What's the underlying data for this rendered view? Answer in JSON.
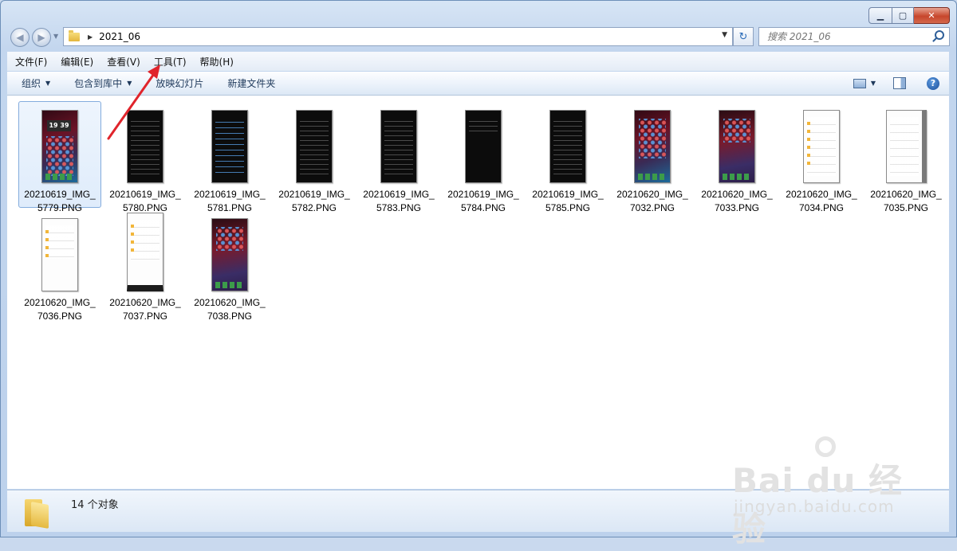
{
  "window": {
    "caption_buttons": [
      "minimize-icon",
      "maximize-icon",
      "close-icon"
    ]
  },
  "address": {
    "path": "2021_06",
    "search_placeholder": "搜索 2021_06"
  },
  "menu": [
    "文件(F)",
    "编辑(E)",
    "查看(V)",
    "工具(T)",
    "帮助(H)"
  ],
  "toolbar": {
    "organize": "组织",
    "include_library": "包含到库中",
    "slideshow": "放映幻灯片",
    "new_folder": "新建文件夹"
  },
  "files": [
    {
      "line1": "20210619_IMG_",
      "line2": "5779.PNG"
    },
    {
      "line1": "20210619_IMG_",
      "line2": "5780.PNG"
    },
    {
      "line1": "20210619_IMG_",
      "line2": "5781.PNG"
    },
    {
      "line1": "20210619_IMG_",
      "line2": "5782.PNG"
    },
    {
      "line1": "20210619_IMG_",
      "line2": "5783.PNG"
    },
    {
      "line1": "20210619_IMG_",
      "line2": "5784.PNG"
    },
    {
      "line1": "20210619_IMG_",
      "line2": "5785.PNG"
    },
    {
      "line1": "20210620_IMG_",
      "line2": "7032.PNG"
    },
    {
      "line1": "20210620_IMG_",
      "line2": "7033.PNG"
    },
    {
      "line1": "20210620_IMG_",
      "line2": "7034.PNG"
    },
    {
      "line1": "20210620_IMG_",
      "line2": "7035.PNG"
    },
    {
      "line1": "20210620_IMG_",
      "line2": "7036.PNG"
    },
    {
      "line1": "20210620_IMG_",
      "line2": "7037.PNG"
    },
    {
      "line1": "20210620_IMG_",
      "line2": "7038.PNG"
    }
  ],
  "thumb_clock": "19 39",
  "status": {
    "count_text": "14 个对象"
  },
  "watermark": {
    "brand": "Bai du 经验",
    "url": "jingyan.baidu.com"
  },
  "colors": {
    "annotation_arrow": "#e0242b",
    "selection_border": "#84acdd"
  }
}
